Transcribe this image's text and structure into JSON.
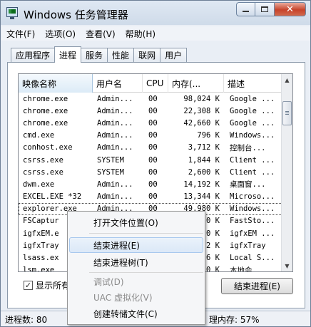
{
  "window": {
    "title": "Windows 任务管理器",
    "icon": "task-manager-icon",
    "buttons": {
      "minimize": "minimize-icon",
      "maximize": "maximize-icon",
      "close": "✕"
    }
  },
  "menubar": [
    "文件(F)",
    "选项(O)",
    "查看(V)",
    "帮助(H)"
  ],
  "tabs": [
    "应用程序",
    "进程",
    "服务",
    "性能",
    "联网",
    "用户"
  ],
  "active_tab": "进程",
  "columns": [
    "映像名称",
    "用户名",
    "CPU",
    "内存(...",
    "描述"
  ],
  "processes": [
    {
      "name": "chrome.exe",
      "user": "Admin...",
      "cpu": "00",
      "mem": "98,024 K",
      "desc": "Google ..."
    },
    {
      "name": "chrome.exe",
      "user": "Admin...",
      "cpu": "00",
      "mem": "22,308 K",
      "desc": "Google ..."
    },
    {
      "name": "chrome.exe",
      "user": "Admin...",
      "cpu": "00",
      "mem": "42,660 K",
      "desc": "Google ..."
    },
    {
      "name": "cmd.exe",
      "user": "Admin...",
      "cpu": "00",
      "mem": "796 K",
      "desc": "Windows..."
    },
    {
      "name": "conhost.exe",
      "user": "Admin...",
      "cpu": "00",
      "mem": "3,712 K",
      "desc": "控制台..."
    },
    {
      "name": "csrss.exe",
      "user": "SYSTEM",
      "cpu": "00",
      "mem": "1,844 K",
      "desc": "Client ..."
    },
    {
      "name": "csrss.exe",
      "user": "SYSTEM",
      "cpu": "00",
      "mem": "2,600 K",
      "desc": "Client ..."
    },
    {
      "name": "dwm.exe",
      "user": "Admin...",
      "cpu": "00",
      "mem": "14,192 K",
      "desc": "桌面窗..."
    },
    {
      "name": "EXCEL.EXE *32",
      "user": "Admin...",
      "cpu": "00",
      "mem": "13,344 K",
      "desc": "Microso..."
    },
    {
      "name": "explorer.exe",
      "user": "Admin...",
      "cpu": "00",
      "mem": "49,980 K",
      "desc": "Windows..."
    },
    {
      "name": "FSCaptur",
      "user": "",
      "cpu": "",
      "mem": "0 K",
      "desc": "FastSto..."
    },
    {
      "name": "igfxEM.e",
      "user": "",
      "cpu": "",
      "mem": "0 K",
      "desc": "igfxEM ..."
    },
    {
      "name": "igfxTray",
      "user": "",
      "cpu": "",
      "mem": "2 K",
      "desc": "igfxTray"
    },
    {
      "name": "lsass.ex",
      "user": "",
      "cpu": "",
      "mem": "6 K",
      "desc": "Local S..."
    },
    {
      "name": "lsm.exe",
      "user": "",
      "cpu": "",
      "mem": "0 K",
      "desc": "本地会..."
    }
  ],
  "selected_row": 9,
  "show_all_label": "显示所有",
  "end_process_button": "结束进程(E)",
  "status": {
    "processes": "进程数: 80",
    "memory": "理内存: 57%"
  },
  "context_menu": {
    "items": [
      {
        "label": "打开文件位置(O)",
        "enabled": true
      },
      {
        "label": "结束进程(E)",
        "enabled": true,
        "highlighted": true
      },
      {
        "label": "结束进程树(T)",
        "enabled": true
      },
      {
        "label": "调试(D)",
        "enabled": false
      },
      {
        "label": "UAC 虚拟化(V)",
        "enabled": false
      },
      {
        "label": "创建转储文件(C)",
        "enabled": true
      }
    ]
  }
}
